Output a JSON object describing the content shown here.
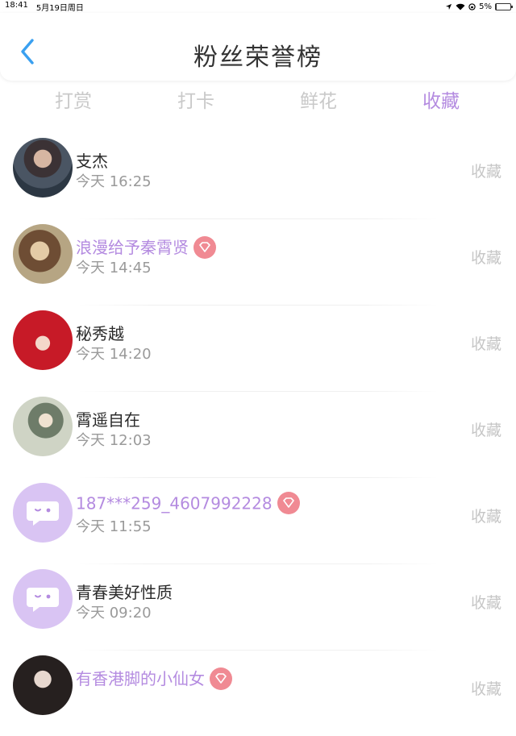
{
  "status": {
    "time": "18:41",
    "date": "5月19日周日",
    "battery": "5%",
    "battery_level": 0.05
  },
  "header": {
    "title": "粉丝荣誉榜",
    "back_icon": "chevron-left-icon"
  },
  "tabs": [
    {
      "label": "打赏",
      "active": false
    },
    {
      "label": "打卡",
      "active": false
    },
    {
      "label": "鲜花",
      "active": false
    },
    {
      "label": "收藏",
      "active": true
    }
  ],
  "colors": {
    "accent": "#b48be0",
    "gem": "#f08a93",
    "inactive_tab": "#c9c9c9"
  },
  "fans": [
    {
      "name": "支杰",
      "time": "今天 16:25",
      "action": "收藏",
      "vip": false
    },
    {
      "name": "浪漫给予秦霄贤",
      "time": "今天 14:45",
      "action": "收藏",
      "vip": true
    },
    {
      "name": "秘秀越",
      "time": "今天 14:20",
      "action": "收藏",
      "vip": false
    },
    {
      "name": "霄遥自在",
      "time": "今天 12:03",
      "action": "收藏",
      "vip": false
    },
    {
      "name": "187***259_4607992228",
      "time": "今天 11:55",
      "action": "收藏",
      "vip": true
    },
    {
      "name": "青春美好性质",
      "time": "今天 09:20",
      "action": "收藏",
      "vip": false
    },
    {
      "name": "有香港脚的小仙女",
      "time": "",
      "action": "收藏",
      "vip": true
    }
  ]
}
